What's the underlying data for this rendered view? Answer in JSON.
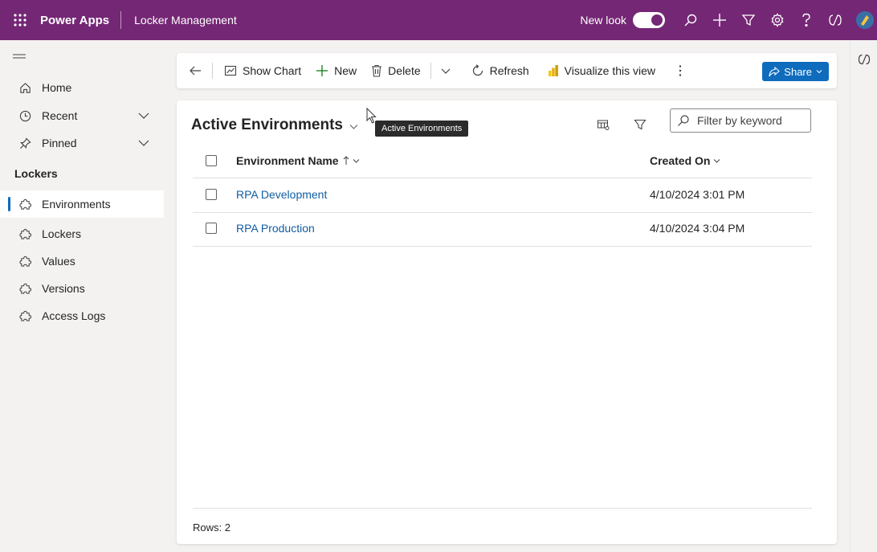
{
  "topbar": {
    "brand": "Power Apps",
    "app_name": "Locker Management",
    "new_look_label": "New look"
  },
  "sidebar": {
    "items": [
      {
        "label": "Home",
        "icon": "home-icon"
      },
      {
        "label": "Recent",
        "icon": "clock-icon"
      },
      {
        "label": "Pinned",
        "icon": "pin-icon"
      }
    ],
    "group_label": "Lockers",
    "entities": [
      {
        "label": "Environments",
        "icon": "puzzle-icon",
        "active": true
      },
      {
        "label": "Lockers",
        "icon": "puzzle-icon"
      },
      {
        "label": "Values",
        "icon": "puzzle-icon"
      },
      {
        "label": "Versions",
        "icon": "puzzle-icon"
      },
      {
        "label": "Access Logs",
        "icon": "puzzle-icon"
      }
    ]
  },
  "commands": {
    "show_chart": "Show Chart",
    "new": "New",
    "delete": "Delete",
    "refresh": "Refresh",
    "visualize": "Visualize this view",
    "share": "Share"
  },
  "view": {
    "title": "Active Environments",
    "tooltip": "Active Environments",
    "filter_placeholder": "Filter by keyword"
  },
  "grid": {
    "columns": [
      "Environment Name",
      "Created On"
    ],
    "rows": [
      {
        "name": "RPA Development",
        "created": "4/10/2024 3:01 PM"
      },
      {
        "name": "RPA Production",
        "created": "4/10/2024 3:04 PM"
      }
    ],
    "rows_label": "Rows: 2"
  },
  "colors": {
    "header": "#742774",
    "accent": "#0f6cbd",
    "link": "#115ea3"
  }
}
